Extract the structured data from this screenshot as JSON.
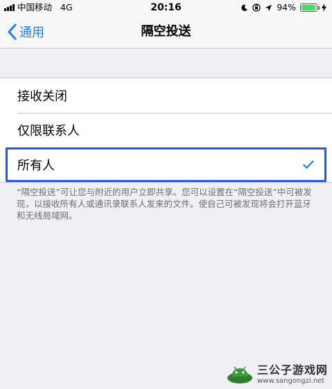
{
  "status_bar": {
    "carrier": "中国移动",
    "network": "4G",
    "time": "20:16",
    "battery_percent_text": "94%",
    "battery_level": 0.94,
    "icons": [
      "moon-icon",
      "orientation-lock-icon",
      "location-icon",
      "charging-bolt-icon"
    ]
  },
  "nav": {
    "back_label": "通用",
    "title": "隔空投送"
  },
  "options": [
    {
      "label": "接收关闭",
      "selected": false
    },
    {
      "label": "仅限联系人",
      "selected": false
    },
    {
      "label": "所有人",
      "selected": true
    }
  ],
  "footer": "“隔空投送”可让您与附近的用户立即共享。您可以设置在“隔空投送”中可被发现，以接收所有人或通讯录联系人发来的文件。使自己可被发现将会打开蓝牙和无线局域网。",
  "watermark": {
    "title": "三公子游戏网",
    "url": "www.sangongzi.net"
  },
  "colors": {
    "accent": "#1a7cf5",
    "selection_outline": "#2b58d6",
    "battery_green": "#4cd964",
    "background": "#efeff4"
  }
}
